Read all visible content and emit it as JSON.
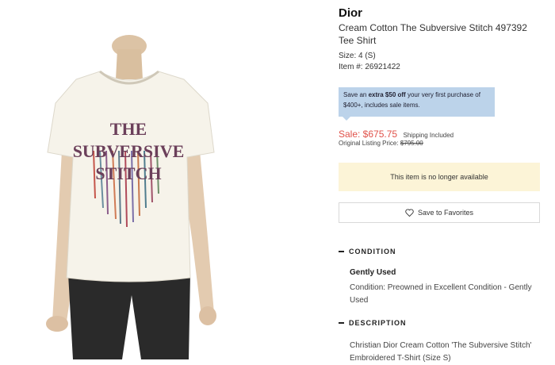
{
  "product": {
    "brand": "Dior",
    "title": "Cream Cotton The Subversive Stitch 497392 Tee Shirt",
    "size": "Size: 4 (S)",
    "item_number": "Item #: 26921422"
  },
  "promo": {
    "prefix": "Save an ",
    "bold": "extra $50 off",
    "suffix": " your very first purchase of $400+, includes sale items."
  },
  "pricing": {
    "sale_label": "Sale: $675.75",
    "shipping": "Shipping Included",
    "original_label": "Original Listing Price: ",
    "original_price": "$795.00",
    "sale_color": "#e0524a"
  },
  "availability": {
    "notice": "This item is no longer available"
  },
  "favorites": {
    "label": "Save to Favorites",
    "icon": "heart-icon"
  },
  "condition": {
    "heading": "CONDITION",
    "title": "Gently Used",
    "text": "Condition: Preowned in Excellent Condition - Gently Used"
  },
  "description": {
    "heading": "DESCRIPTION",
    "text": "Christian Dior Cream Cotton 'The Subversive Stitch' Embroidered T-Shirt (Size S)"
  },
  "image": {
    "shirt_print": [
      "THE",
      "SUBVERSIVE",
      "STITCH"
    ]
  }
}
